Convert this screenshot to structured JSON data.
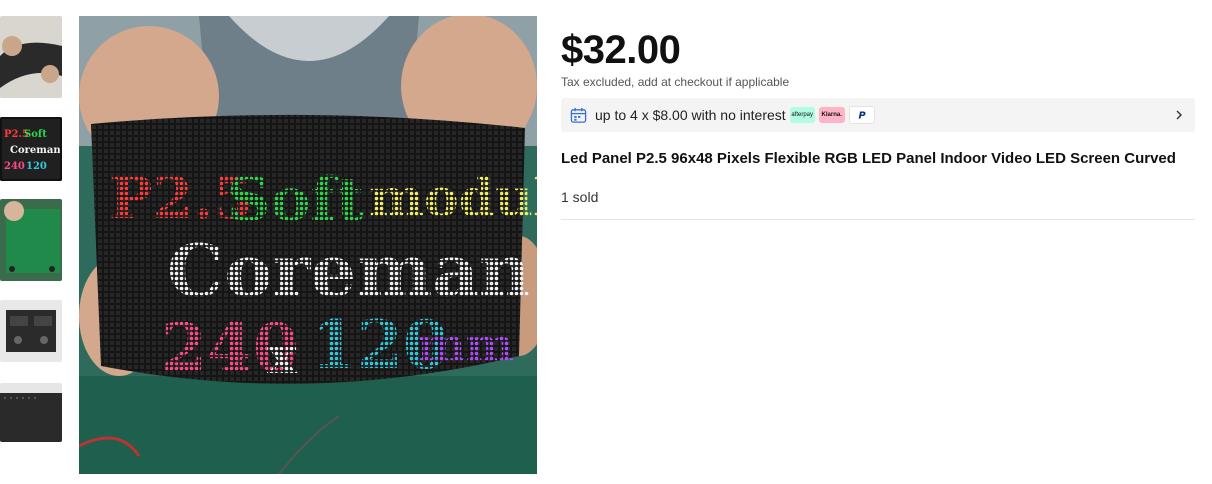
{
  "gallery": {
    "thumbnails": [
      {
        "alt": "flexible LED panel held curved"
      },
      {
        "alt": "LED panel displaying text"
      },
      {
        "alt": "LED module in hand"
      },
      {
        "alt": "LED panel back side"
      },
      {
        "alt": "LED panel close-up"
      }
    ],
    "selected_index": 1,
    "main_image_text": {
      "line1_a": "P2.5",
      "line1_b": "Soft",
      "line1_c": "module",
      "line2": "Coreman",
      "line3_a": "240",
      "line3_b": "x",
      "line3_c": "120",
      "line3_d": "mm"
    }
  },
  "product": {
    "price": "$32.00",
    "tax_note": "Tax excluded, add at checkout if applicable",
    "installments": "up to 4 x $8.00 with no interest",
    "payment_badges": {
      "afterpay": "afterpay",
      "klarna": "Klarna.",
      "paypal": "P"
    },
    "title": "Led Panel P2.5 96x48 Pixels Flexible RGB LED Panel Indoor Video LED Screen Curved",
    "sold": "1 sold"
  },
  "colors": {
    "afterpay": "#b2fce4",
    "klarna": "#ffb3c7",
    "paypal_blue": "#003087",
    "led_red": "#ff3b3b",
    "led_green": "#2fd64a",
    "led_yellow": "#f2ee6a",
    "led_white": "#f4f4f4",
    "led_pink": "#ff4a8a",
    "led_cyan": "#33c9dc",
    "led_purple": "#b04bff"
  }
}
